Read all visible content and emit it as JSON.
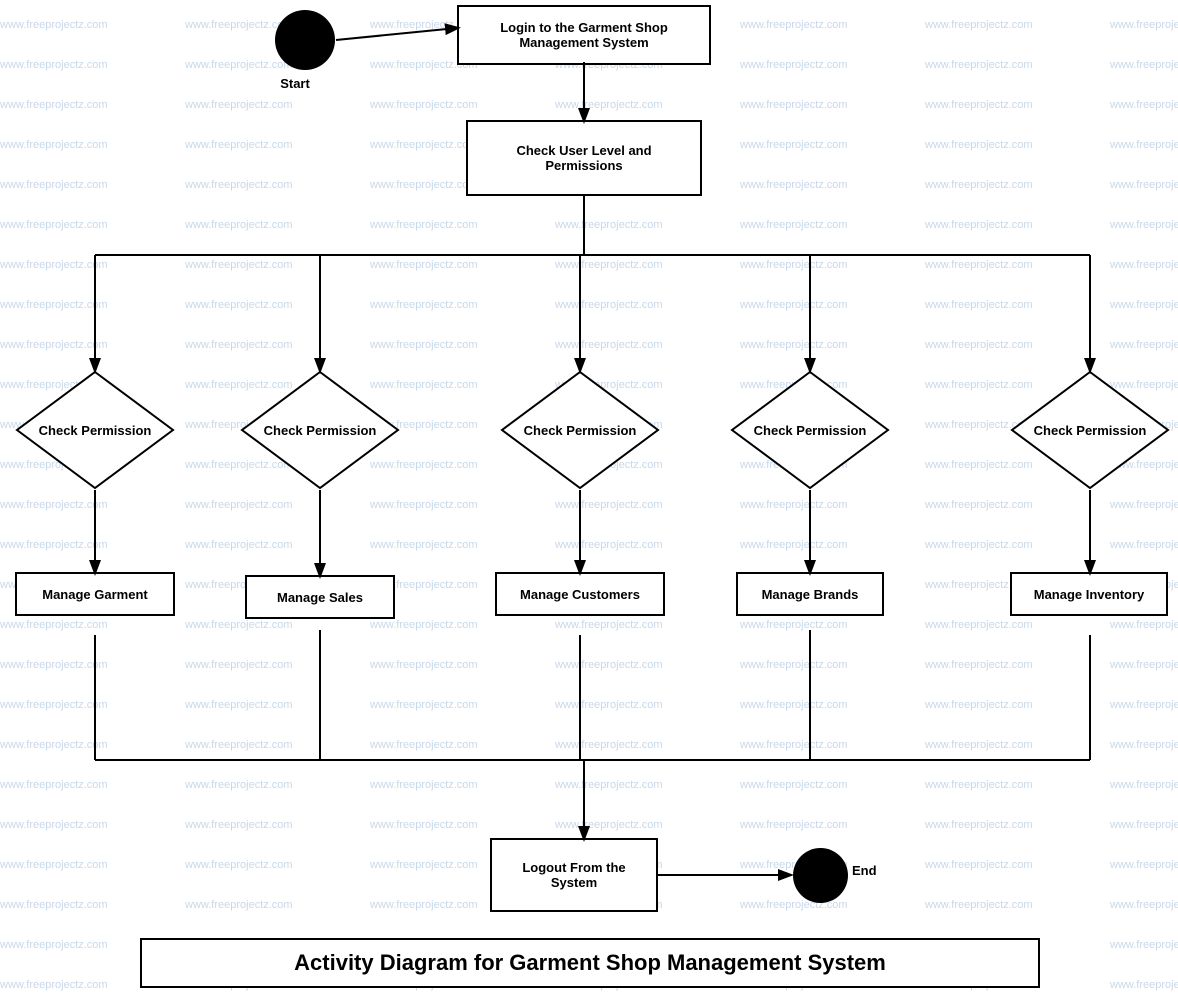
{
  "title": "Activity Diagram for Garment Shop Management System",
  "nodes": {
    "start_label": "Start",
    "end_label": "End",
    "login": "Login to the Garment Shop Management System",
    "check_user_level": "Check User Level and Permissions",
    "check_permission_1": "Check Permission",
    "check_permission_2": "Check Permission",
    "check_permission_3": "Check Permission",
    "check_permission_4": "Check Permission",
    "check_permission_5": "Check Permission",
    "manage_garment": "Manage Garment",
    "manage_sales": "Manage Sales",
    "manage_customers": "Manage Customers",
    "manage_brands": "Manage Brands",
    "manage_inventory": "Manage Inventory",
    "logout": "Logout From the System"
  },
  "watermark": "www.freeprojectz.com",
  "colors": {
    "border": "#000000",
    "background": "#ffffff",
    "watermark": "#c8d8e8"
  }
}
